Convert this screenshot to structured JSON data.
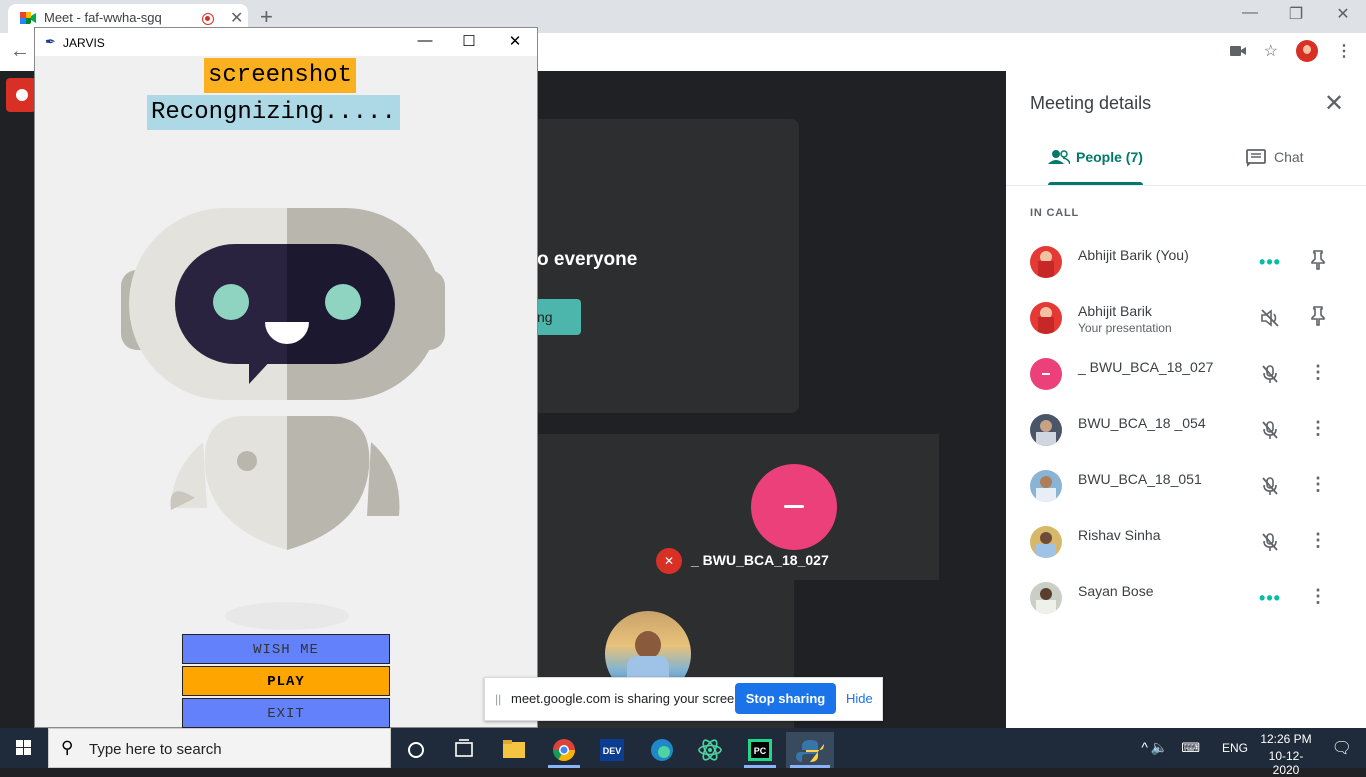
{
  "browser": {
    "tab_title": "Meet - faf-wwha-sgq",
    "tab_close": "✕",
    "new_tab": "+",
    "minimize": "—",
    "restore": "❐",
    "close": "✕",
    "back": "←"
  },
  "meet": {
    "card_text": "o everyone",
    "card_button": "ng",
    "tile_name": "_ BWU_BCA_18_027"
  },
  "panel": {
    "title": "Meeting details",
    "tab_people": "People (7)",
    "tab_chat": "Chat",
    "section": "IN CALL",
    "participants": [
      {
        "name": "Abhijit Barik (You)",
        "sub": "",
        "a1": "•••",
        "a2": "pin"
      },
      {
        "name": "Abhijit Barik",
        "sub": "Your presentation",
        "a1": "volume-off",
        "a2": "pin"
      },
      {
        "name": "_ BWU_BCA_18_027",
        "sub": "",
        "a1": "mic-off",
        "a2": "more"
      },
      {
        "name": "BWU_BCA_18 _054",
        "sub": "",
        "a1": "mic-off",
        "a2": "more"
      },
      {
        "name": "BWU_BCA_18_051",
        "sub": "",
        "a1": "mic-off",
        "a2": "more"
      },
      {
        "name": "Rishav Sinha",
        "sub": "",
        "a1": "mic-off",
        "a2": "more"
      },
      {
        "name": "Sayan Bose",
        "sub": "",
        "a1": "•••",
        "a2": "more"
      }
    ]
  },
  "jarvis": {
    "title": "JARVIS",
    "label1": "screenshot",
    "label2": "Recongnizing.....",
    "btn_wish": "WISH ME",
    "btn_play": "PLAY",
    "btn_exit": "EXIT"
  },
  "share": {
    "text": "meet.google.com is sharing your screen.",
    "stop": "Stop sharing",
    "hide": "Hide"
  },
  "taskbar": {
    "search_placeholder": "Type here to search",
    "lang": "ENG",
    "time": "12:26 PM",
    "date": "10-12-2020"
  },
  "colors": {
    "teal": "#00796b",
    "jarvis_orange": "#fbb01f",
    "jarvis_blue": "#add8e6",
    "button_blue": "#6281fb",
    "stop_blue": "#1a73e8"
  }
}
